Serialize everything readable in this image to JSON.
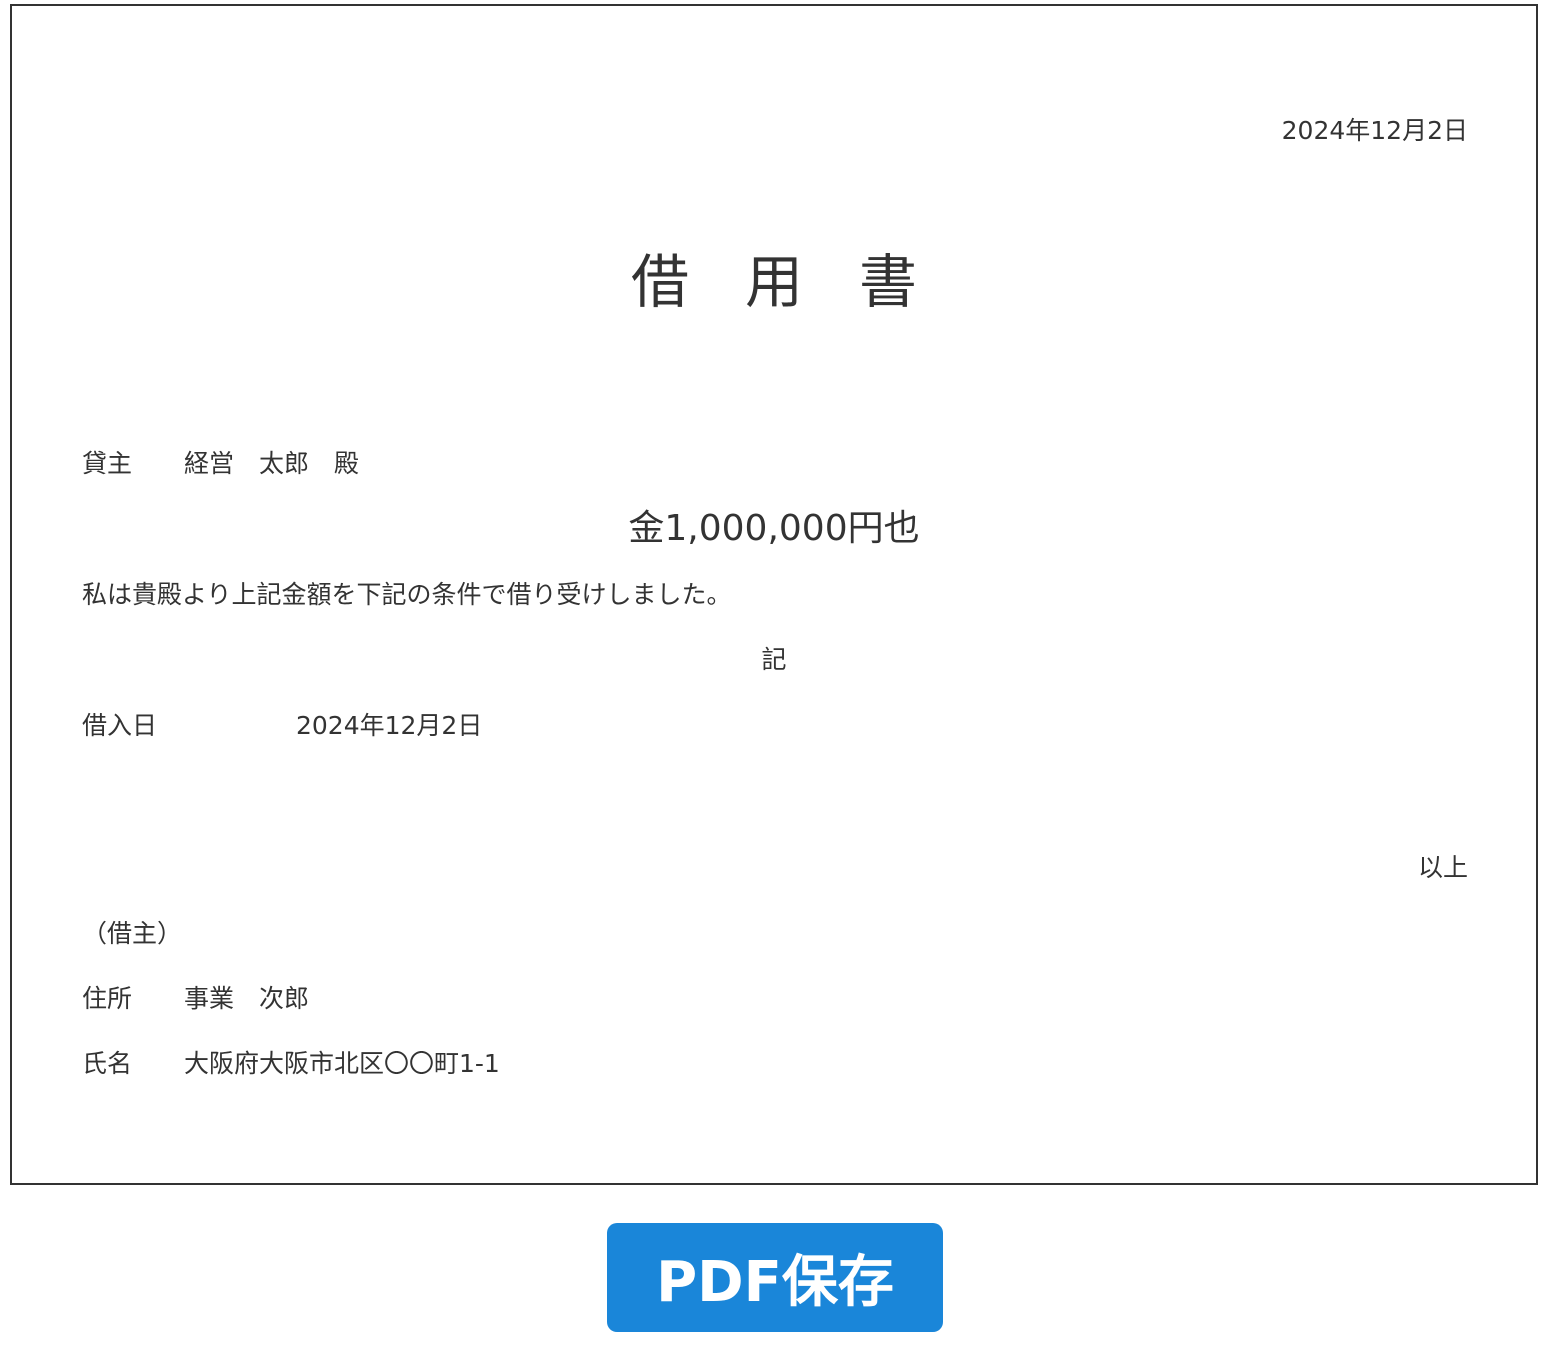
{
  "document": {
    "date": "2024年12月2日",
    "title_chars": [
      "借",
      "用",
      "書"
    ],
    "lender_label": "貸主",
    "lender_name": "経営　太郎　殿",
    "amount": "金1,000,000円也",
    "statement": "私は貴殿より上記金額を下記の条件で借り受けしました。",
    "ki": "記",
    "borrow_date_label": "借入日",
    "borrow_date_value": "2024年12月2日",
    "ijou": "以上",
    "borrower_heading": "（借主）",
    "address_label": "住所",
    "address_value": "事業　次郎",
    "name_label": "氏名",
    "name_value": "大阪府大阪市北区〇〇町1-1"
  },
  "actions": {
    "pdf_save_label": "PDF保存"
  },
  "colors": {
    "button_bg": "#1a86d9",
    "text": "#333333",
    "border": "#333333"
  }
}
